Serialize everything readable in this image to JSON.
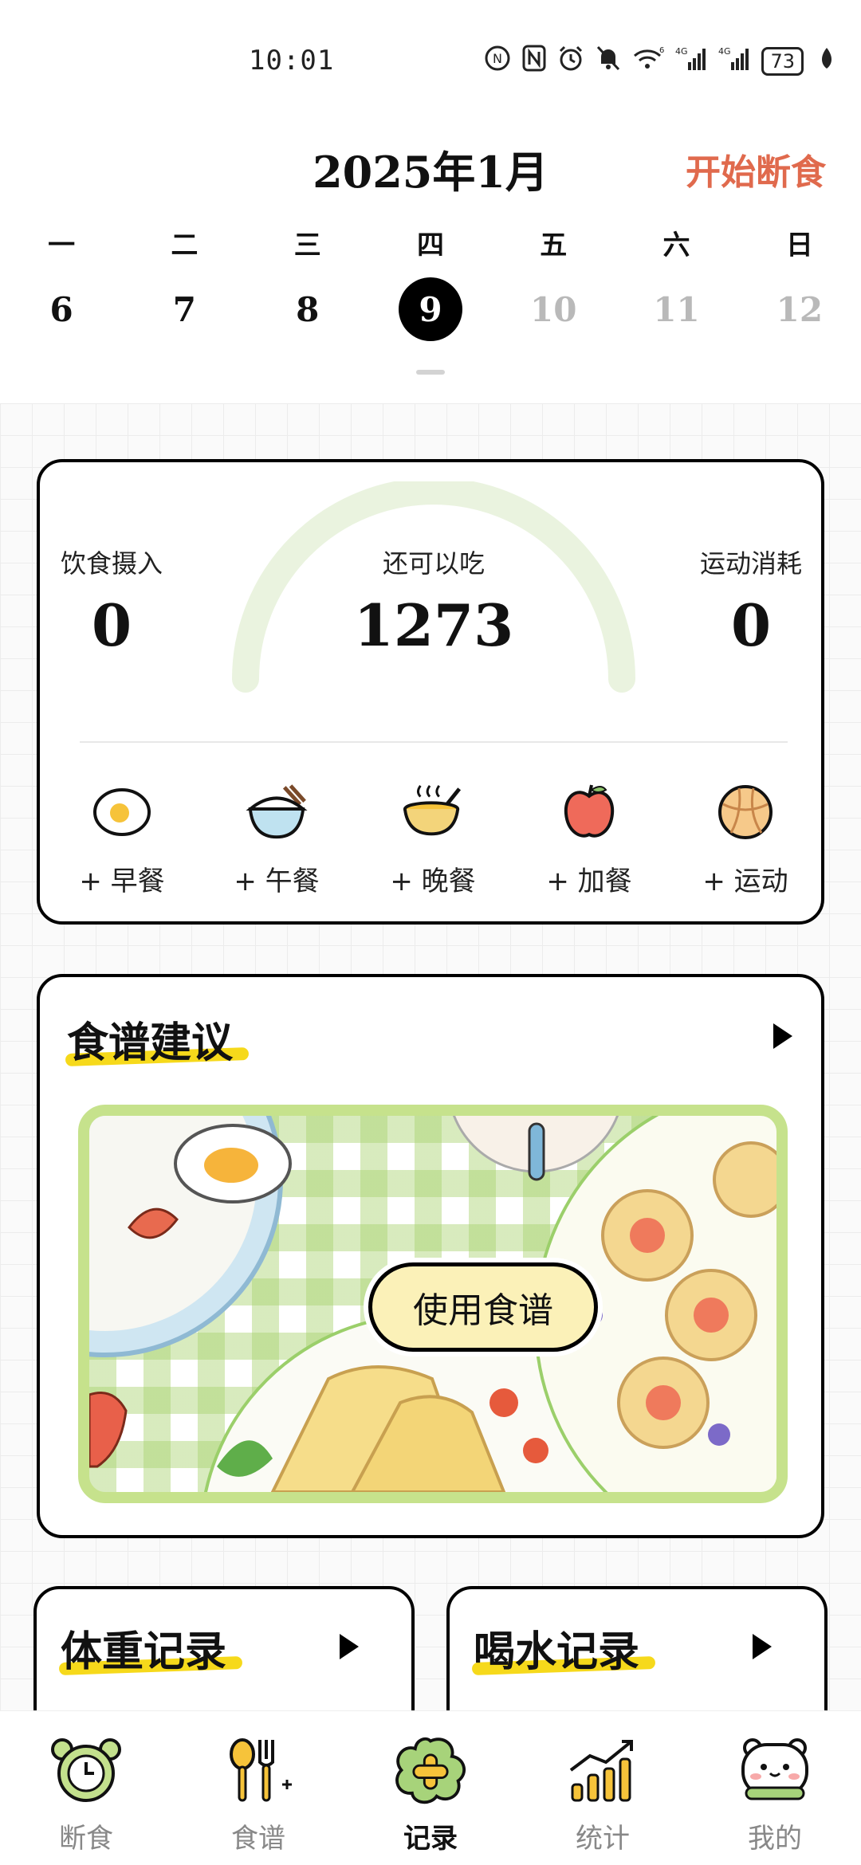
{
  "status": {
    "time": "10:01",
    "icons": [
      "nfc-circle-icon",
      "n-icon",
      "alarm-icon",
      "mute-icon",
      "wifi-6-icon",
      "signal-4g-icon",
      "signal-4g-icon"
    ],
    "wifi_label": "6",
    "sim1": "4G",
    "sim2": "4G",
    "battery": "73"
  },
  "header": {
    "month": "2025年1月",
    "start_fasting": "开始断食"
  },
  "week": {
    "days": [
      "一",
      "二",
      "三",
      "四",
      "五",
      "六",
      "日"
    ],
    "dates": [
      "6",
      "7",
      "8",
      "9",
      "10",
      "11",
      "12"
    ],
    "selected": "9"
  },
  "calories": {
    "intake_label": "饮食摄入",
    "intake_value": "0",
    "remaining_label": "还可以吃",
    "remaining_value": "1273",
    "burn_label": "运动消耗",
    "burn_value": "0",
    "meals": [
      {
        "label": "+ 早餐",
        "icon": "egg-icon"
      },
      {
        "label": "+ 午餐",
        "icon": "rice-bowl-icon"
      },
      {
        "label": "+ 晚餐",
        "icon": "soup-bowl-icon"
      },
      {
        "label": "+ 加餐",
        "icon": "apple-icon"
      },
      {
        "label": "+ 运动",
        "icon": "basketball-icon"
      }
    ]
  },
  "recipe": {
    "title": "食谱建议",
    "button": "使用食谱"
  },
  "weight": {
    "title": "体重记录"
  },
  "water": {
    "title": "喝水记录"
  },
  "nav": {
    "items": [
      {
        "label": "断食",
        "icon": "alarm-clock-icon"
      },
      {
        "label": "食谱",
        "icon": "spoon-fork-icon"
      },
      {
        "label": "记录",
        "icon": "plus-flower-icon"
      },
      {
        "label": "统计",
        "icon": "bar-chart-icon"
      },
      {
        "label": "我的",
        "icon": "bear-face-icon"
      }
    ],
    "active": "记录"
  },
  "colors": {
    "accent_red": "#e06a4d",
    "arc_green": "#eaf3df",
    "frame_green": "#c6e28c",
    "highlight_yellow": "#f6d91b",
    "button_cream": "#fbf1b8"
  }
}
